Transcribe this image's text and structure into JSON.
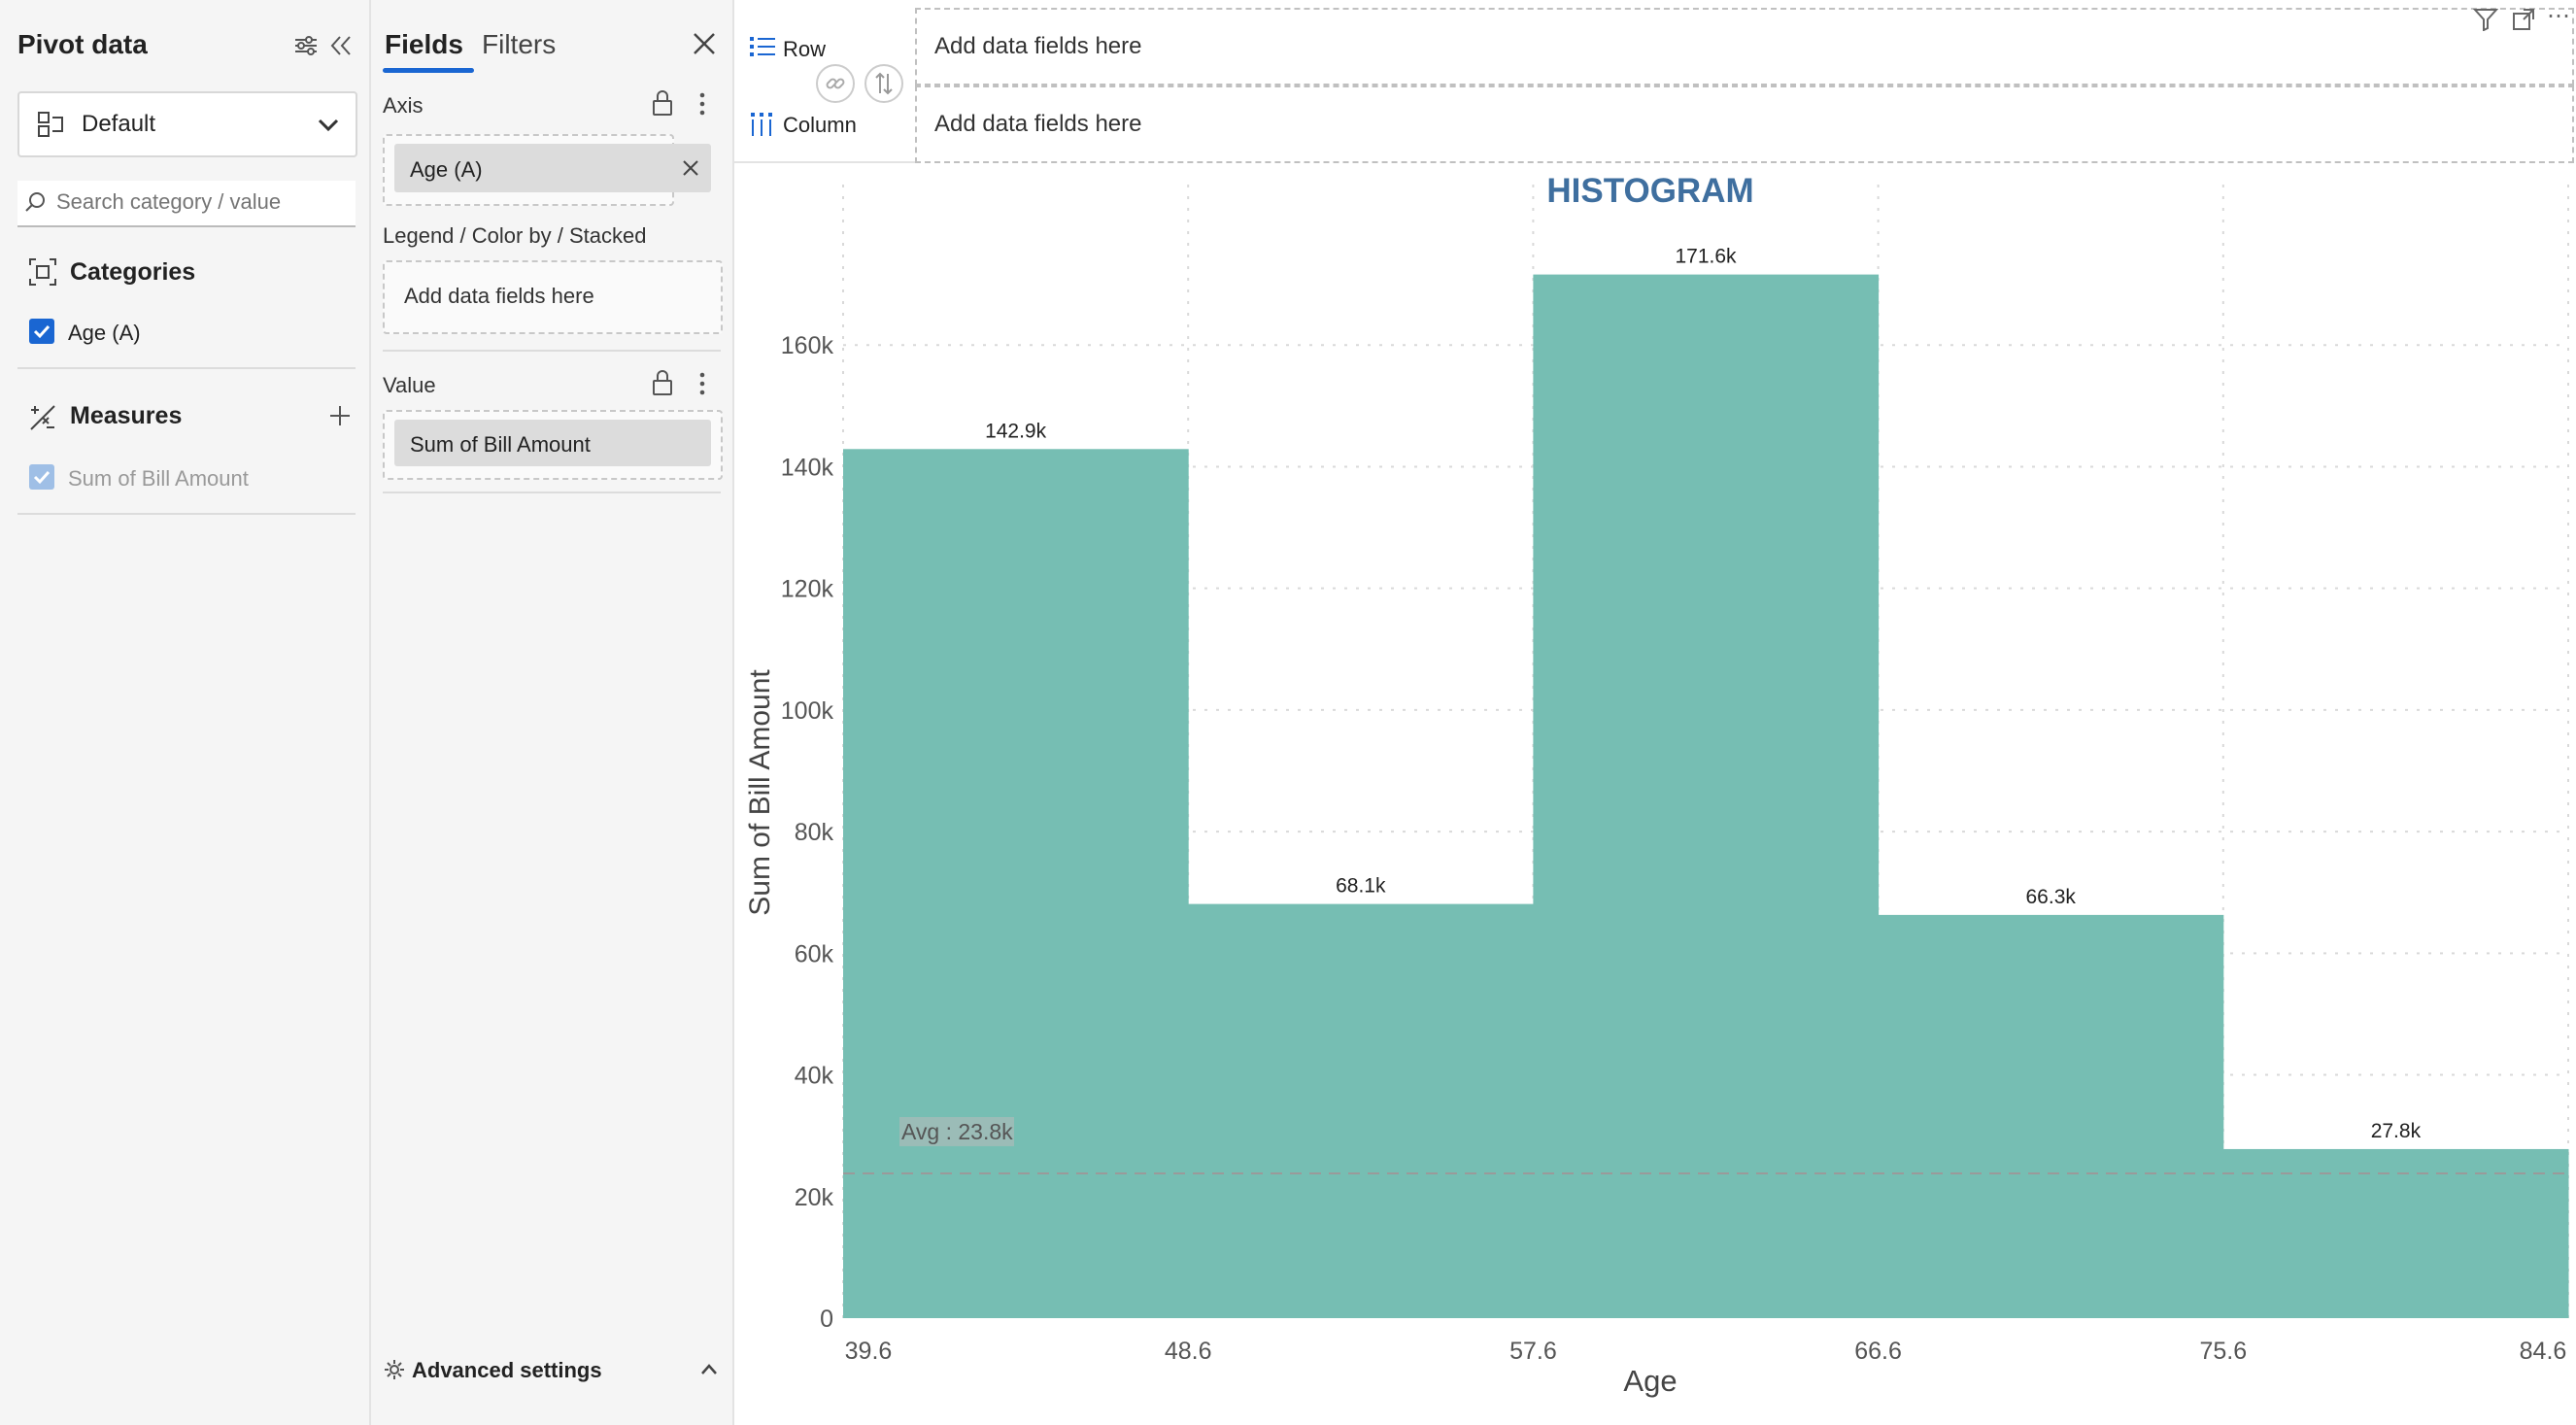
{
  "pivot": {
    "title": "Pivot data",
    "dropdown_value": "Default",
    "search_placeholder": "Search category / value",
    "categories_label": "Categories",
    "category_items": [
      {
        "label": "Age (A)",
        "checked": true
      }
    ],
    "measures_label": "Measures",
    "measure_items": [
      {
        "label": "Sum of Bill Amount",
        "checked": true
      }
    ]
  },
  "fields": {
    "tabs": [
      "Fields",
      "Filters"
    ],
    "axis_label": "Axis",
    "axis_chip": "Age (A)",
    "legend_label": "Legend / Color by / Stacked",
    "legend_placeholder": "Add data fields here",
    "value_label": "Value",
    "value_chip": "Sum of Bill Amount",
    "advanced_settings": "Advanced settings"
  },
  "toolbar": {
    "row_label": "Row",
    "row_placeholder": "Add data fields here",
    "column_label": "Column",
    "column_placeholder": "Add data fields here"
  },
  "chart_data": {
    "type": "bar",
    "title": "HISTOGRAM",
    "xlabel": "Age",
    "ylabel": "Sum of Bill Amount",
    "bin_edges": [
      39.6,
      48.6,
      57.6,
      66.6,
      75.6,
      84.6
    ],
    "values": [
      142900,
      68100,
      171600,
      66300,
      27800
    ],
    "data_labels": [
      "142.9k",
      "68.1k",
      "171.6k",
      "66.3k",
      "27.8k"
    ],
    "x_ticks": [
      "39.6",
      "48.6",
      "57.6",
      "66.6",
      "75.6",
      "84.6"
    ],
    "y_ticks": [
      "0",
      "20k",
      "40k",
      "60k",
      "80k",
      "100k",
      "120k",
      "140k",
      "160k"
    ],
    "y_tick_values": [
      0,
      20000,
      40000,
      60000,
      80000,
      100000,
      120000,
      140000,
      160000
    ],
    "ylim": [
      0,
      180000
    ],
    "average_value": 23800,
    "average_label": "Avg : 23.8k",
    "grid": true,
    "colors": {
      "bar": "#76beb3",
      "title": "#3f6f9f",
      "avg_line": "#9a9a9a"
    }
  }
}
